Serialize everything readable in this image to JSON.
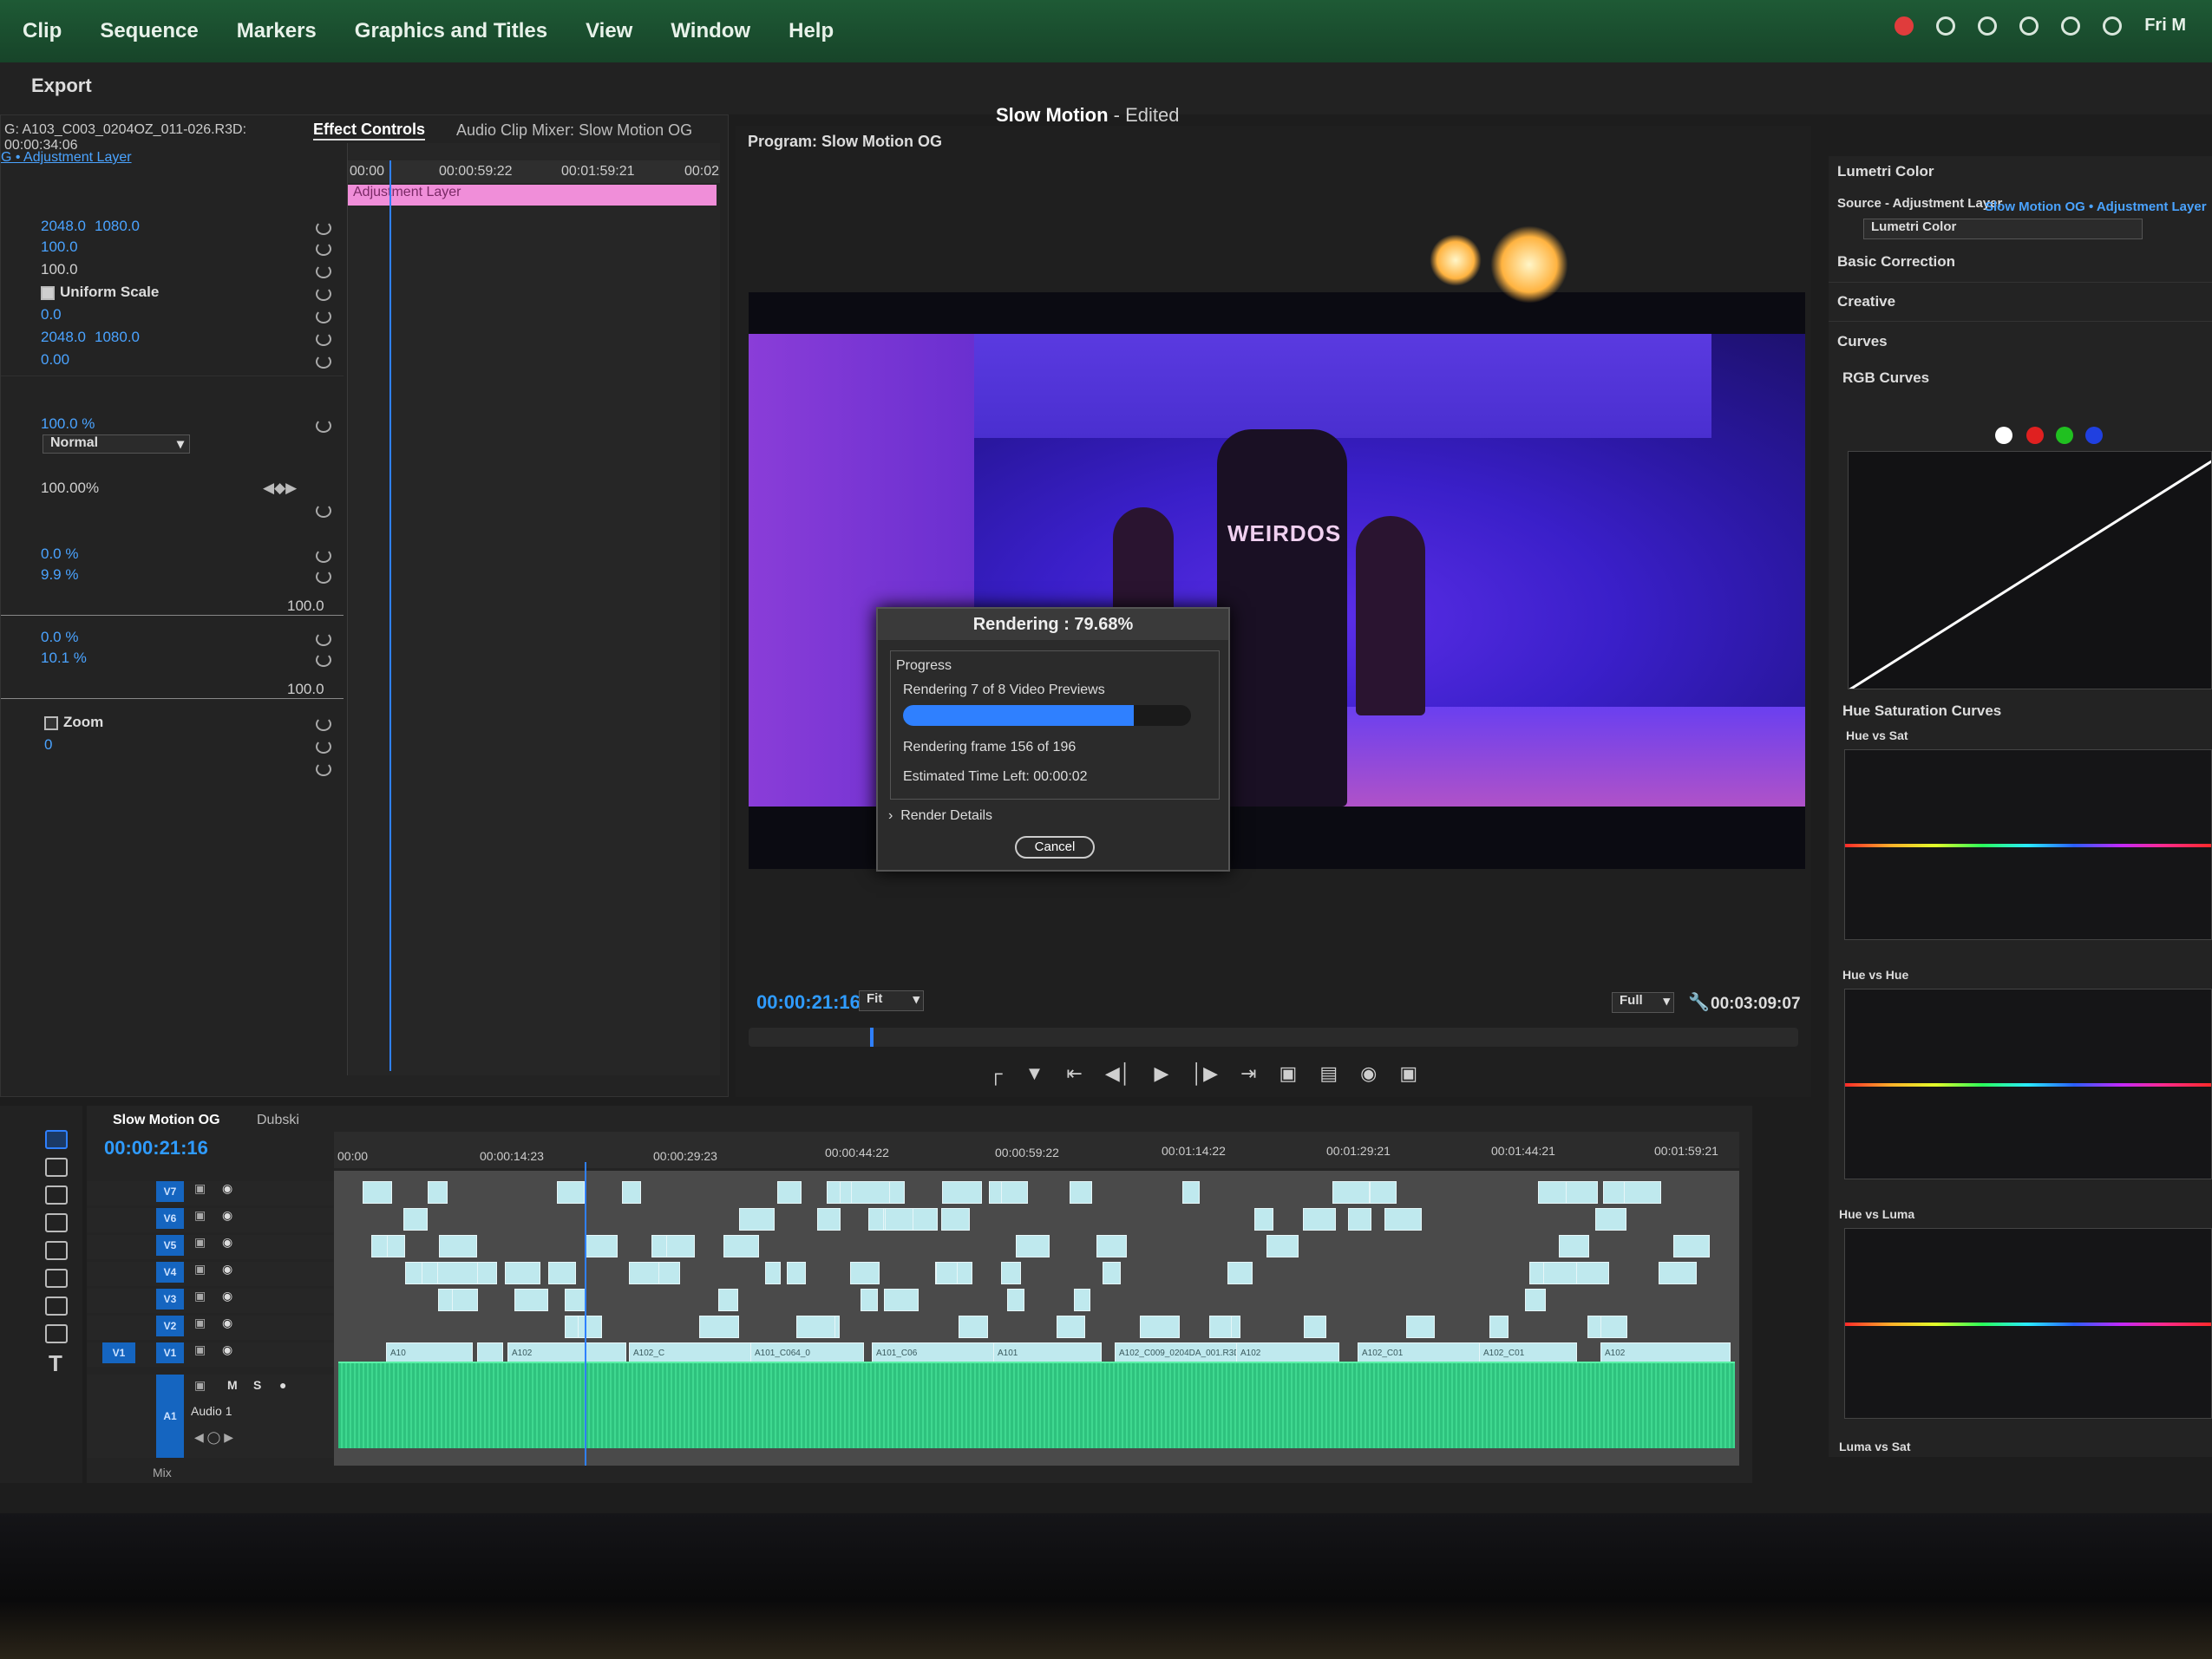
{
  "menubar": {
    "items": [
      "Clip",
      "Sequence",
      "Markers",
      "Graphics and Titles",
      "View",
      "Window",
      "Help"
    ],
    "clock": "Fri M"
  },
  "titlebar": {
    "export_tab": "Export",
    "doc_title": "Slow Motion",
    "doc_status": " - Edited"
  },
  "effect_controls": {
    "source_clip": "G: A103_C003_0204OZ_011-026.R3D: 00:00:34:06",
    "tab_active": "Effect Controls",
    "tab_mixer": "Audio Clip Mixer: Slow Motion OG",
    "layer_label": "G • Adjustment Layer",
    "rows": [
      {
        "a": "2048.0",
        "b": "1080.0"
      },
      {
        "a": "100.0"
      },
      {
        "a": "100.0",
        "white": true
      },
      {
        "check": "Uniform Scale",
        "on": true
      },
      {
        "a": "0.0"
      },
      {
        "a": "2048.0",
        "b": "1080.0"
      },
      {
        "a": "0.00"
      }
    ],
    "opacity": "100.0 %",
    "blend": "Normal",
    "pct": "100.00%",
    "v1": "0.0 %",
    "v2": "9.9 %",
    "max1": "100.0",
    "v3": "0.0 %",
    "v4": "10.1 %",
    "max2": "100.0",
    "zoom": "Zoom",
    "zero": "0",
    "mini_times": [
      "00:00",
      "00:00:59:22",
      "00:01:59:21",
      "00:02"
    ],
    "adj_clip": "Adjustment Layer"
  },
  "program": {
    "title": "Program: Slow Motion OG",
    "timecode": "00:00:21:16",
    "fit": "Fit",
    "quality": "Full",
    "duration": "00:03:09:07",
    "shirt": "WEIRDOS"
  },
  "dialog": {
    "title": "Rendering : 79.68%",
    "group": "Progress",
    "line1": "Rendering 7 of 8 Video Previews",
    "progress": 0.8,
    "line2": "Rendering frame 156 of 196",
    "line3": "Estimated Time Left: 00:00:02",
    "details": "Render Details",
    "cancel": "Cancel"
  },
  "lumetri": {
    "title": "Lumetri Color",
    "source": "Source - Adjustment Layer",
    "target": "Slow Motion OG • Adjustment Layer",
    "fx": "Lumetri Color",
    "sections": [
      "Basic Correction",
      "Creative",
      "Curves"
    ],
    "rgb": "RGB Curves",
    "hue_sat_group": "Hue Saturation Curves",
    "graphs": [
      "Hue vs Sat",
      "Hue vs Hue",
      "Hue vs Luma",
      "Luma vs Sat"
    ]
  },
  "timeline": {
    "tab": "Slow Motion OG",
    "tab2": "Dubski",
    "timecode": "00:00:21:16",
    "ruler": [
      "00:00",
      "00:00:14:23",
      "00:00:29:23",
      "00:00:44:22",
      "00:00:59:22",
      "00:01:14:22",
      "00:01:29:21",
      "00:01:44:21",
      "00:01:59:21"
    ],
    "tracks": [
      "V7",
      "V6",
      "V5",
      "V4",
      "V3",
      "V2",
      "V1"
    ],
    "v1_src": "V1",
    "audio_track": "A1",
    "audio_name": "Audio 1",
    "audio_btns": [
      "M",
      "S"
    ],
    "mix": "Mix",
    "clips": [
      "A10",
      "A102",
      "A102_C",
      "A101_C064_0",
      "A101_C06",
      "A101",
      "A102_C009_0204DA_001.R3D",
      "A102",
      "A102_C01",
      "A102_C01",
      "A102"
    ]
  },
  "colors": {
    "accent": "#2f80ff",
    "menubar": "#1e5a35",
    "clip": "#bfe9ee",
    "adjust": "#f08ed9",
    "audio": "#2ec27e"
  },
  "icons": [
    "pointer-icon",
    "track-select-icon",
    "ripple-edit-icon",
    "razor-icon",
    "slip-icon",
    "pen-icon",
    "rectangle-icon",
    "hand-icon",
    "type-icon",
    "wrench-icon",
    "lock-icon",
    "eye-icon",
    "mic-icon",
    "play-icon",
    "camera-icon",
    "menu-icon",
    "eyedropper-icon"
  ]
}
